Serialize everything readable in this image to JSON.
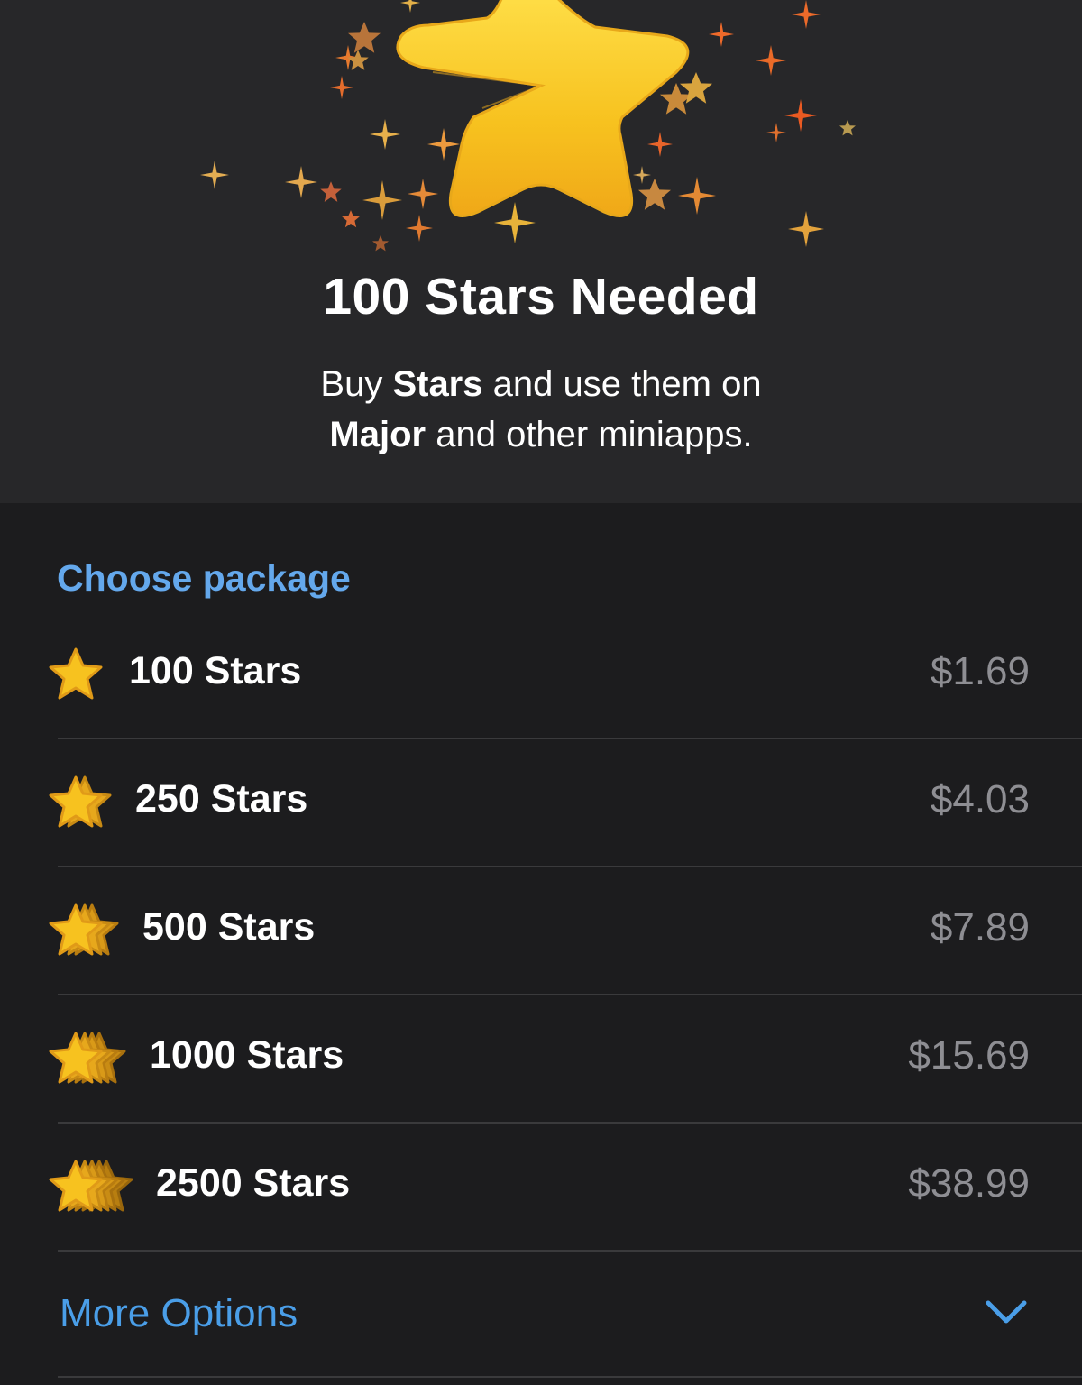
{
  "header": {
    "title": "100 Stars Needed",
    "subtitle_line1_pre": "Buy ",
    "subtitle_line1_bold": "Stars",
    "subtitle_line1_post": " and use them on",
    "subtitle_line2_bold": "Major",
    "subtitle_line2_post": " and other miniapps.",
    "hero_icon": "gold-star-icon"
  },
  "section": {
    "title": "Choose package"
  },
  "packages": [
    {
      "label": "100 Stars",
      "price": "$1.69",
      "icon": "star-stack-1-icon"
    },
    {
      "label": "250 Stars",
      "price": "$4.03",
      "icon": "star-stack-2-icon"
    },
    {
      "label": "500 Stars",
      "price": "$7.89",
      "icon": "star-stack-3-icon"
    },
    {
      "label": "1000 Stars",
      "price": "$15.69",
      "icon": "star-stack-4-icon"
    },
    {
      "label": "2500 Stars",
      "price": "$38.99",
      "icon": "star-stack-5-icon"
    }
  ],
  "more": {
    "label": "More Options",
    "icon": "chevron-down-icon"
  },
  "colors": {
    "accent": "#64a8ec",
    "star_gold": "#f7c21f",
    "price_gray": "#8e8e93",
    "background": "#1c1c1e",
    "header_background": "#272729"
  }
}
